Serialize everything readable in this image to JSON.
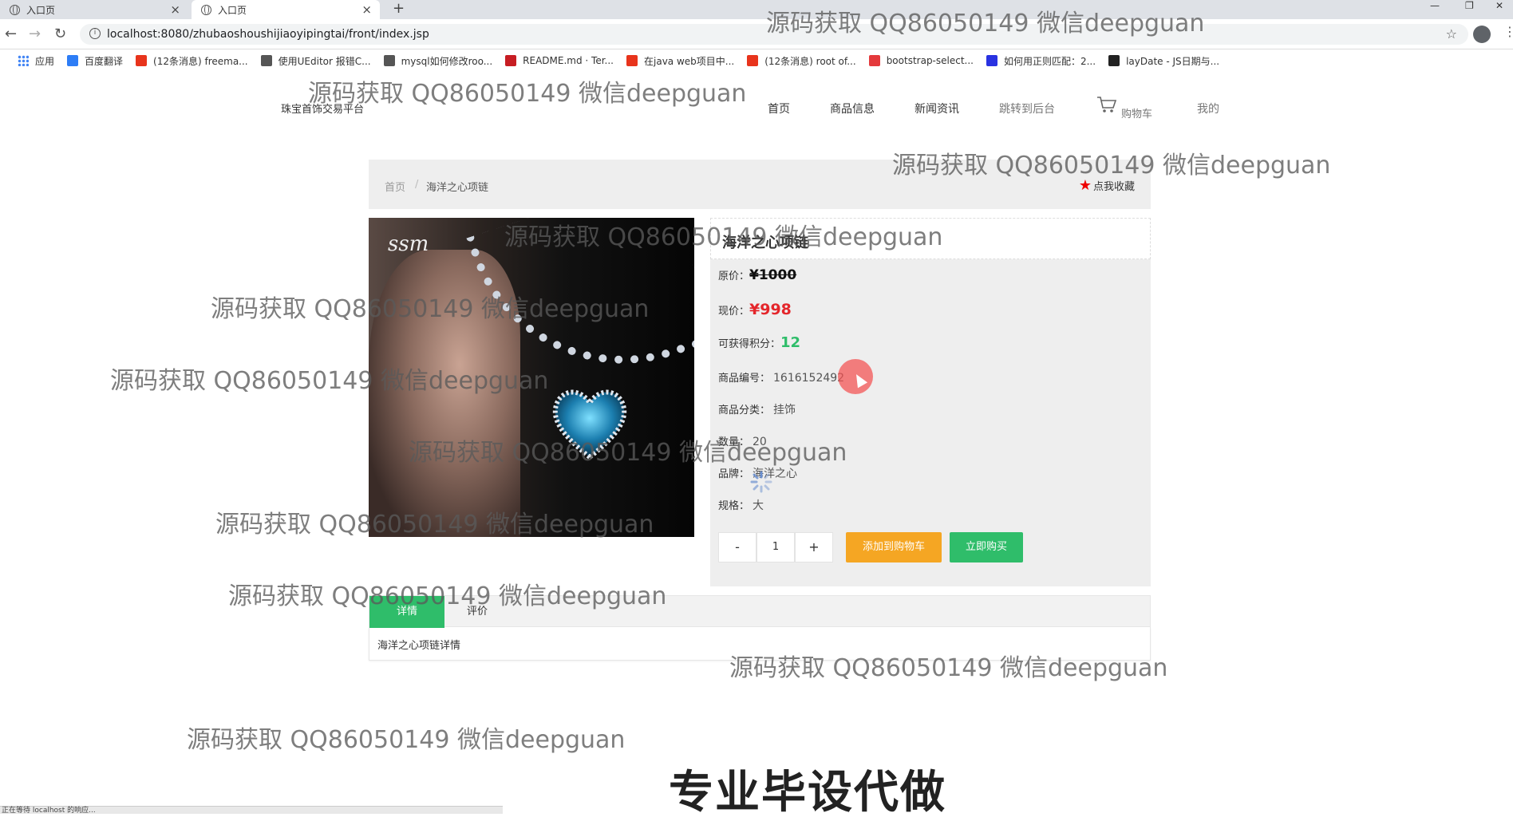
{
  "browser": {
    "tabs": [
      {
        "title": "入口页"
      },
      {
        "title": "入口页"
      }
    ],
    "new_tab_label": "+",
    "url": "localhost:8080/zhubaoshoushijiaoyipingtai/front/index.jsp",
    "bookmarks": [
      {
        "label": "应用",
        "color": "#4285f4"
      },
      {
        "label": "百度翻译",
        "color": "#2d7df6"
      },
      {
        "label": "(12条消息) freema...",
        "color": "#e8341c"
      },
      {
        "label": "使用UEditor 报错C...",
        "color": "#555555"
      },
      {
        "label": "mysql如何修改roo...",
        "color": "#555555"
      },
      {
        "label": "README.md · Ter...",
        "color": "#c71d23"
      },
      {
        "label": "在java web项目中...",
        "color": "#e8341c"
      },
      {
        "label": "(12条消息) root of...",
        "color": "#e8341c"
      },
      {
        "label": "bootstrap-select...",
        "color": "#e4393c"
      },
      {
        "label": "如何用正则匹配：2...",
        "color": "#2932e1"
      },
      {
        "label": "layDate - JS日期与...",
        "color": "#222222"
      }
    ],
    "status_text": "正在等待 localhost 的响应..."
  },
  "site": {
    "logo": "珠宝首饰交易平台",
    "nav": [
      {
        "label": "首页",
        "color": "#333333"
      },
      {
        "label": "商品信息",
        "color": "#333333"
      },
      {
        "label": "新闻资讯",
        "color": "#333333"
      },
      {
        "label": "跳转到后台",
        "color": "#777777"
      },
      {
        "label": "购物车",
        "color": "#777777"
      },
      {
        "label": "我的",
        "color": "#777777"
      }
    ]
  },
  "breadcrumb": {
    "home": "首页",
    "separator": "/",
    "current": "海洋之心项链",
    "favorite_label": "点我收藏"
  },
  "product": {
    "image_brand": "ssm",
    "title": "海洋之心项链",
    "original_price_label": "原价：",
    "original_price": "¥1000",
    "price_label": "现价：",
    "price": "¥998",
    "points_label": "可获得积分：",
    "points": "12",
    "code_label": "商品编号：",
    "code": "1616152492",
    "category_label": "商品分类：",
    "category": "挂饰",
    "quantity_label": "数量：",
    "quantity_stock": "20",
    "brand_label": "品牌：",
    "brand": "海洋之心",
    "spec_label": "规格：",
    "spec": "大",
    "qty_minus": "-",
    "qty_value": "1",
    "qty_plus": "+",
    "add_to_cart": "添加到购物车",
    "buy_now": "立即购买",
    "colors": {
      "price": "#e4262b",
      "points": "#2fbd6a",
      "cart_button": "#f5a623",
      "buy_button": "#2fbd6a"
    }
  },
  "detail": {
    "tabs": [
      {
        "label": "详情"
      },
      {
        "label": "评价"
      }
    ],
    "content": "海洋之心项链详情"
  },
  "watermark": "源码获取 QQ86050149 微信deepguan",
  "promo": "专业毕设代做"
}
